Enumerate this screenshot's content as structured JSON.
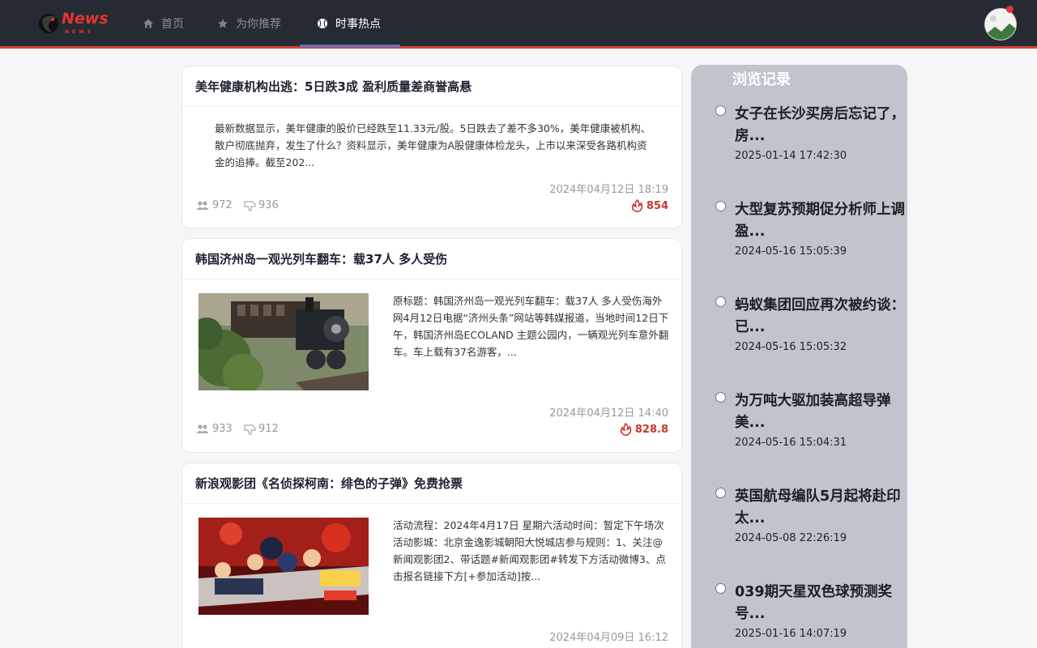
{
  "brand": {
    "name": "News",
    "sub": "NEWS"
  },
  "nav": [
    {
      "label": "首页",
      "icon": "home-icon"
    },
    {
      "label": "为你推荐",
      "icon": "star-icon"
    },
    {
      "label": "时事热点",
      "icon": "baseball-icon"
    }
  ],
  "active_nav": "时事热点",
  "colors": {
    "navbar": "#252a33",
    "accent": "#d9453c",
    "hot": "#c8372e",
    "panel": "#c0c4cc"
  },
  "articles": [
    {
      "title": "美年健康机构出逃：5日跌3成 盈利质量差商誉高悬",
      "summary": "最新数据显示，美年健康的股价已经跌至11.33元/股。5日跌去了差不多30%，美年健康被机构、散户彻底抛弃，发生了什么？资料显示，美年健康为A股健康体检龙头，上市以来深受各路机构资金的追捧。截至202...",
      "date": "2024年04月12日 18:19",
      "views": "972",
      "dislikes": "936",
      "hot": "854"
    },
    {
      "title": "韩国济州岛一观光列车翻车：载37人 多人受伤",
      "summary": "原标题：韩国济州岛一观光列车翻车：载37人 多人受伤海外网4月12日电据“济州头条”网站等韩媒报道，当地时间12日下午，韩国济州岛ECOLAND 主题公园内，一辆观光列车意外翻车。车上载有37名游客，...",
      "date": "2024年04月12日 14:40",
      "views": "933",
      "dislikes": "912",
      "hot": "828.8"
    },
    {
      "title": "新浪观影团《名侦探柯南：绯色的子弹》免费抢票",
      "summary": "活动流程：2024年4月17日 星期六活动时间：暂定下午场次活动影城：北京金逸影城朝阳大悦城店参与规则：1、关注@新闻观影团2、带话题#新闻观影团#转发下方活动微博3、点击报名链接下方[+参加活动]按...",
      "date": "2024年04月09日 16:12"
    }
  ],
  "history": {
    "title": "浏览记录",
    "items": [
      {
        "title": "女子在长沙买房后忘记了，房...",
        "time": "2025-01-14 17:42:30"
      },
      {
        "title": "大型复苏预期促分析师上调盈...",
        "time": "2024-05-16 15:05:39"
      },
      {
        "title": "蚂蚁集团回应再次被约谈：已...",
        "time": "2024-05-16 15:05:32"
      },
      {
        "title": "为万吨大驱加装高超导弹美...",
        "time": "2024-05-16 15:04:31"
      },
      {
        "title": "英国航母编队5月起将赴印太...",
        "time": "2024-05-08 22:26:19"
      },
      {
        "title": "039期天星双色球预测奖号...",
        "time": "2025-01-16 14:07:19"
      }
    ]
  }
}
